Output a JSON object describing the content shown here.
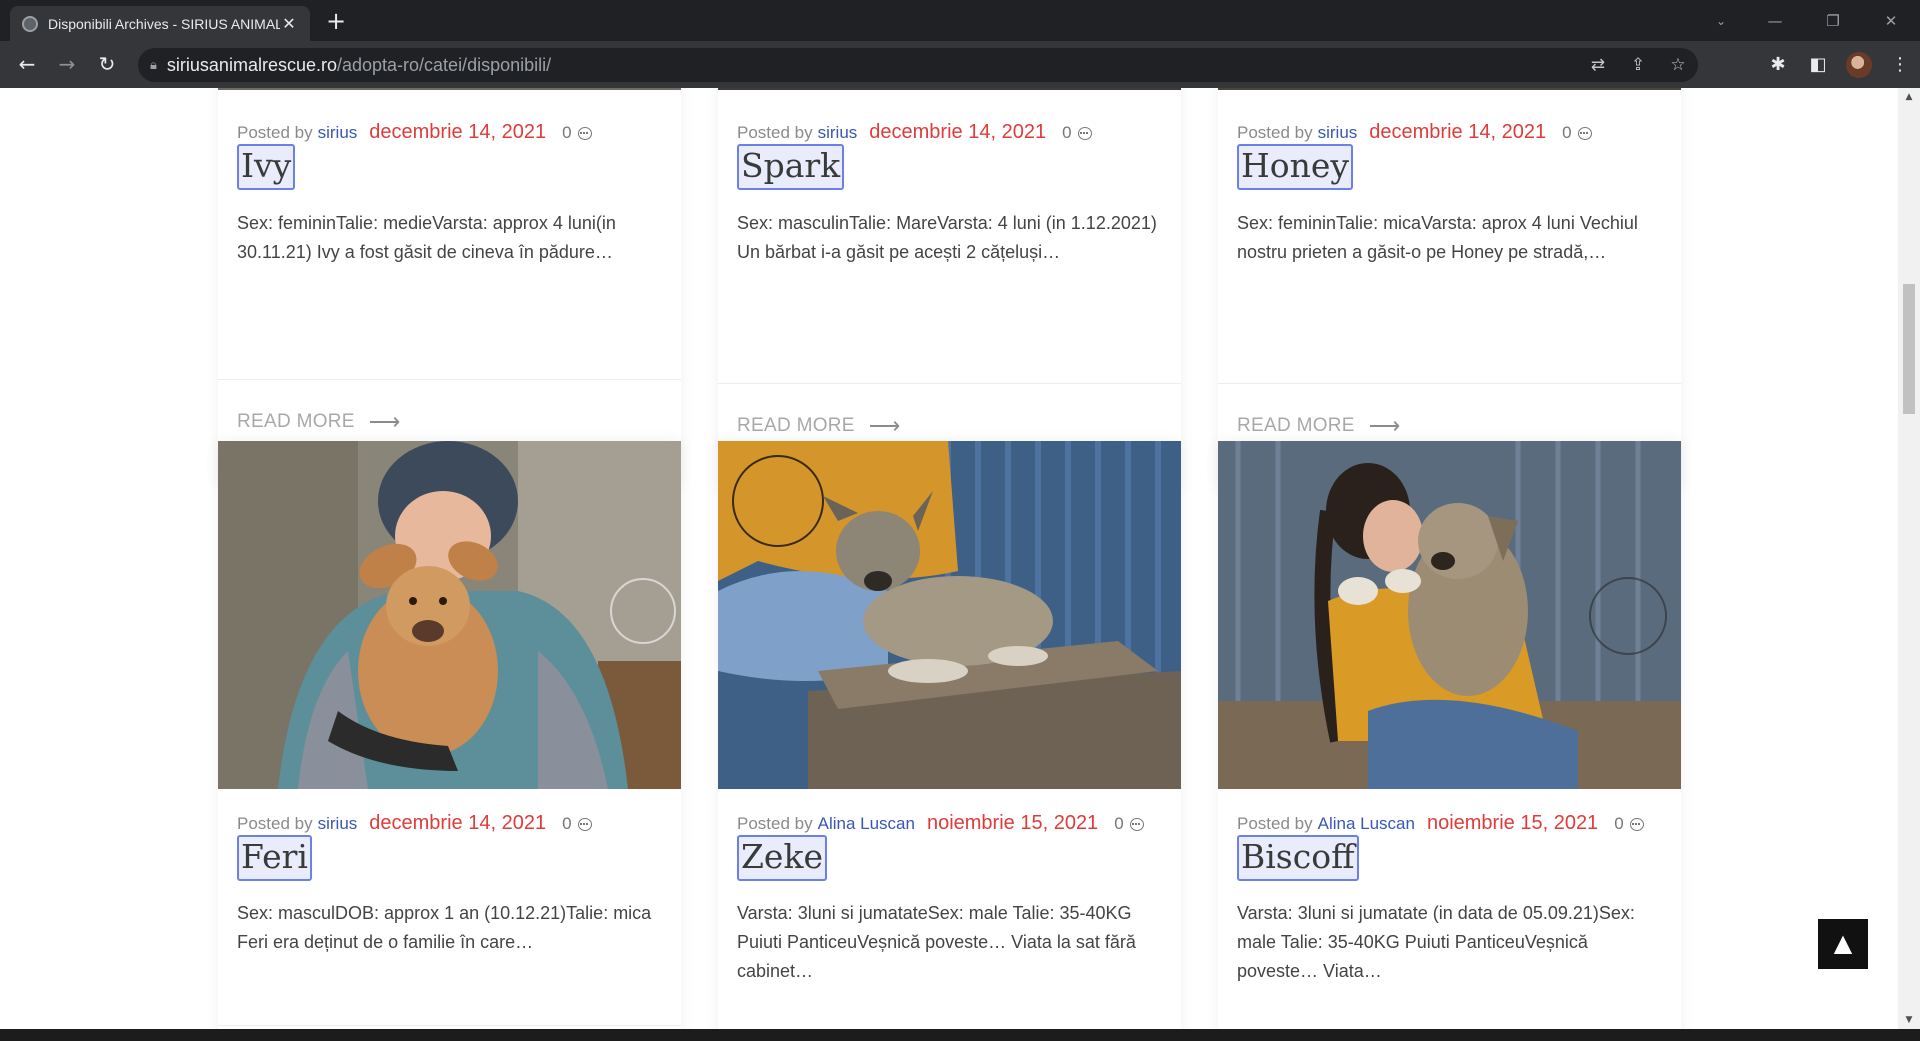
{
  "browser": {
    "tab_title": "Disponibili Archives - SIRIUS ANIMAL RESCUE",
    "tab_close": "✕",
    "new_tab": "+",
    "url_host": "siriusanimalrescue.ro",
    "url_path": "/adopta-ro/catei/disponibili/",
    "back": "←",
    "forward": "→",
    "reload": "↻",
    "win_dropdown": "⌄",
    "win_minimize": "—",
    "win_restore": "❐",
    "win_close": "✕",
    "omni_translate": "⇄",
    "omni_share": "⇪",
    "omni_star": "☆",
    "extensions": "✱",
    "sidepanel": "◧",
    "menu": "⋮"
  },
  "posts_row1": [
    {
      "posted_by": "Posted by",
      "author": "sirius",
      "date": "decembrie 14, 2021",
      "comments": "0",
      "title": "Ivy",
      "excerpt": "Sex: femininTalie: medieVarsta: approx 4 luni(in 30.11.21) Ivy a fost găsit de cineva în pădure…",
      "read_more": "READ MORE"
    },
    {
      "posted_by": "Posted by",
      "author": "sirius",
      "date": "decembrie 14, 2021",
      "comments": "0",
      "title": "Spark",
      "excerpt": "Sex: masculinTalie: MareVarsta: 4 luni (in 1.12.2021) Un bărbat i-a găsit pe acești 2 cățeluși…",
      "read_more": "READ MORE"
    },
    {
      "posted_by": "Posted by",
      "author": "sirius",
      "date": "decembrie 14, 2021",
      "comments": "0",
      "title": "Honey",
      "excerpt": "Sex: femininTalie: micaVarsta: aprox 4 luni Vechiul nostru prieten a găsit-o pe Honey pe stradă,…",
      "read_more": "READ MORE"
    }
  ],
  "posts_row2": [
    {
      "posted_by": "Posted by",
      "author": "sirius",
      "date": "decembrie 14, 2021",
      "comments": "0",
      "title": "Feri",
      "excerpt": "Sex: masculDOB: approx 1 an (10.12.21)Talie: mica Feri era deținut de o familie în care…"
    },
    {
      "posted_by": "Posted by",
      "author": "Alina Luscan",
      "date": "noiembrie 15, 2021",
      "comments": "0",
      "title": "Zeke",
      "excerpt": "Varsta: 3luni si jumatateSex: male Talie: 35-40KG Puiuti PanticeuVeșnică poveste… Viata la sat fără cabinet…"
    },
    {
      "posted_by": "Posted by",
      "author": "Alina Luscan",
      "date": "noiembrie 15, 2021",
      "comments": "0",
      "title": "Biscoff",
      "excerpt": "Varsta: 3luni si jumatate (in data de 05.09.21)Sex: male Talie: 35-40KG Puiuti PanticeuVeșnică poveste… Viata…"
    }
  ],
  "back_to_top": "▲",
  "colors": {
    "author": "#3a57b5",
    "date": "#e03b3b",
    "title_highlight": "#6d7fe8"
  }
}
